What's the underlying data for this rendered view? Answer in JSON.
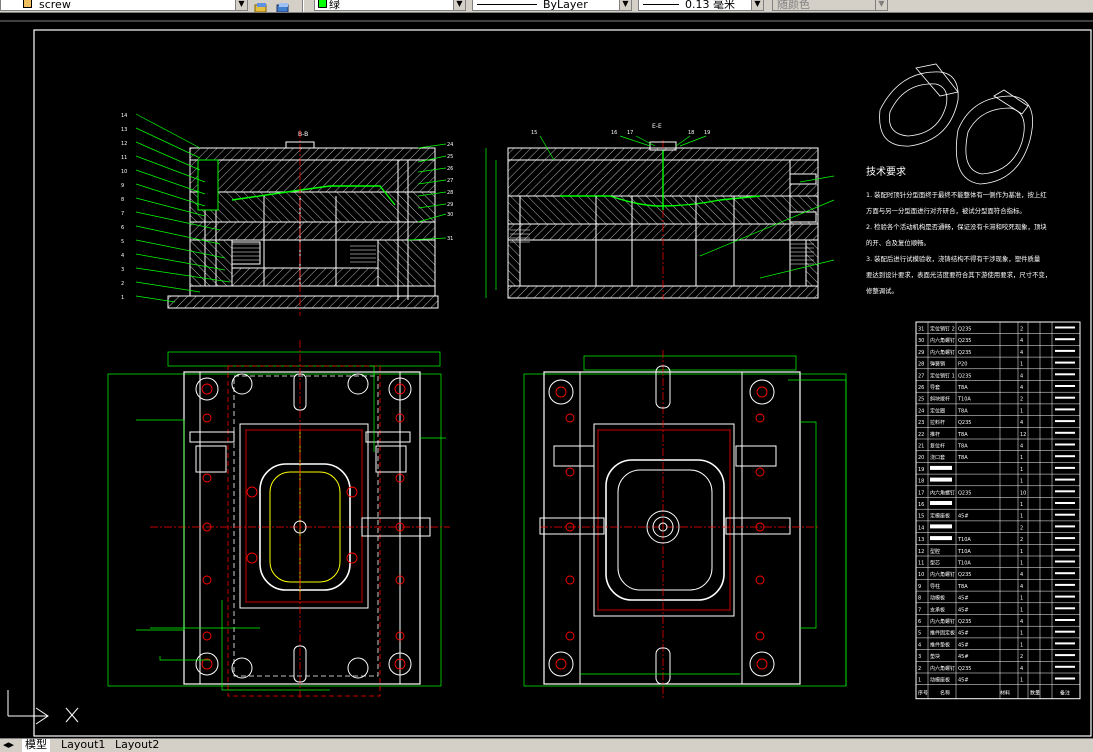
{
  "toolbar": {
    "layer_name": "screw",
    "color_name": "绿",
    "linetype": "ByLayer",
    "lineweight": "0.13 毫米",
    "plotstyle": "随颜色"
  },
  "drawing": {
    "section_a": "B-B",
    "section_b": "E-E",
    "notes_title": "技术要求",
    "notes": [
      "1. 装配时顶针分型面终于最终不能整体有一侧作为基准，按上红",
      "方面与另一分型面进行对齐研合，被试分型面符合指标。",
      "2. 检验各个活动机构是否通畅，保证没有卡滞和咬死现象，顶块",
      "的开、合及复位顺畅。",
      "3. 装配后进行试模验收，浇铸结构不得有干涉现象，塑件质量",
      "要达到设计要求，表面光洁度要符合其下游使用要求，尺寸不变，",
      "修整调试。"
    ],
    "left_callouts": [
      "14",
      "13",
      "12",
      "11",
      "10",
      "9",
      "8",
      "7",
      "6",
      "5",
      "4",
      "3",
      "2",
      "1"
    ],
    "right_callouts": [
      "24",
      "25",
      "26",
      "27",
      "28",
      "29",
      "30",
      "31"
    ],
    "top_callouts": [
      "15",
      "16",
      "17",
      "18",
      "19"
    ],
    "bom_rows": [
      {
        "no": "31",
        "name": "定位销钉 2",
        "mat": "Q235",
        "qty": "2"
      },
      {
        "no": "30",
        "name": "内六角螺钉",
        "mat": "Q235",
        "qty": "4"
      },
      {
        "no": "29",
        "name": "内六角螺钉",
        "mat": "Q235",
        "qty": "4"
      },
      {
        "no": "28",
        "name": "弹簧销",
        "mat": "P20",
        "qty": "1"
      },
      {
        "no": "27",
        "name": "定位销钉 1",
        "mat": "Q235",
        "qty": "4"
      },
      {
        "no": "26",
        "name": "导套",
        "mat": "T8A",
        "qty": "4"
      },
      {
        "no": "25",
        "name": "斜块拨杆",
        "mat": "T10A",
        "qty": "2"
      },
      {
        "no": "24",
        "name": "定位圈",
        "mat": "T8A",
        "qty": "1"
      },
      {
        "no": "23",
        "name": "拉料杆",
        "mat": "Q235",
        "qty": "4"
      },
      {
        "no": "22",
        "name": "推杆",
        "mat": "T8A",
        "qty": "12"
      },
      {
        "no": "21",
        "name": "复位杆",
        "mat": "T8A",
        "qty": "4"
      },
      {
        "no": "20",
        "name": "浇口套",
        "mat": "T8A",
        "qty": "1"
      },
      {
        "no": "19",
        "name": "",
        "mat": "",
        "qty": "1"
      },
      {
        "no": "18",
        "name": "",
        "mat": "",
        "qty": "1"
      },
      {
        "no": "17",
        "name": "内六角螺钉",
        "mat": "Q235",
        "qty": "10"
      },
      {
        "no": "16",
        "name": "",
        "mat": "",
        "qty": "1"
      },
      {
        "no": "15",
        "name": "定模座板",
        "mat": "45#",
        "qty": "1"
      },
      {
        "no": "14",
        "name": "",
        "mat": "",
        "qty": "2"
      },
      {
        "no": "13",
        "name": "",
        "mat": "T10A",
        "qty": "2"
      },
      {
        "no": "12",
        "name": "型腔",
        "mat": "T10A",
        "qty": "1"
      },
      {
        "no": "11",
        "name": "型芯",
        "mat": "T10A",
        "qty": "1"
      },
      {
        "no": "10",
        "name": "内六角螺钉",
        "mat": "Q235",
        "qty": "4"
      },
      {
        "no": "9",
        "name": "导柱",
        "mat": "T8A",
        "qty": "4"
      },
      {
        "no": "8",
        "name": "动模板",
        "mat": "45#",
        "qty": "1"
      },
      {
        "no": "7",
        "name": "支承板",
        "mat": "45#",
        "qty": "1"
      },
      {
        "no": "6",
        "name": "内六角螺钉",
        "mat": "Q235",
        "qty": "4"
      },
      {
        "no": "5",
        "name": "推件固定板",
        "mat": "45#",
        "qty": "1"
      },
      {
        "no": "4",
        "name": "推件垫板",
        "mat": "45#",
        "qty": "1"
      },
      {
        "no": "3",
        "name": "垫块",
        "mat": "45#",
        "qty": "2"
      },
      {
        "no": "2",
        "name": "内六角螺钉",
        "mat": "Q235",
        "qty": "4"
      },
      {
        "no": "1",
        "name": "动模座板",
        "mat": "45#",
        "qty": "1"
      }
    ],
    "bom_header": [
      "序号",
      "名称",
      "材料",
      "数量",
      "备注"
    ]
  },
  "tabs": [
    "模型",
    "Layout1",
    "Layout2"
  ],
  "colors": {
    "background": "#000000",
    "outline": "#ffffff",
    "dimension": "#00ff00",
    "center": "#ff0000",
    "hatch": "#ffffff",
    "chrome": "#d4d0c8"
  }
}
